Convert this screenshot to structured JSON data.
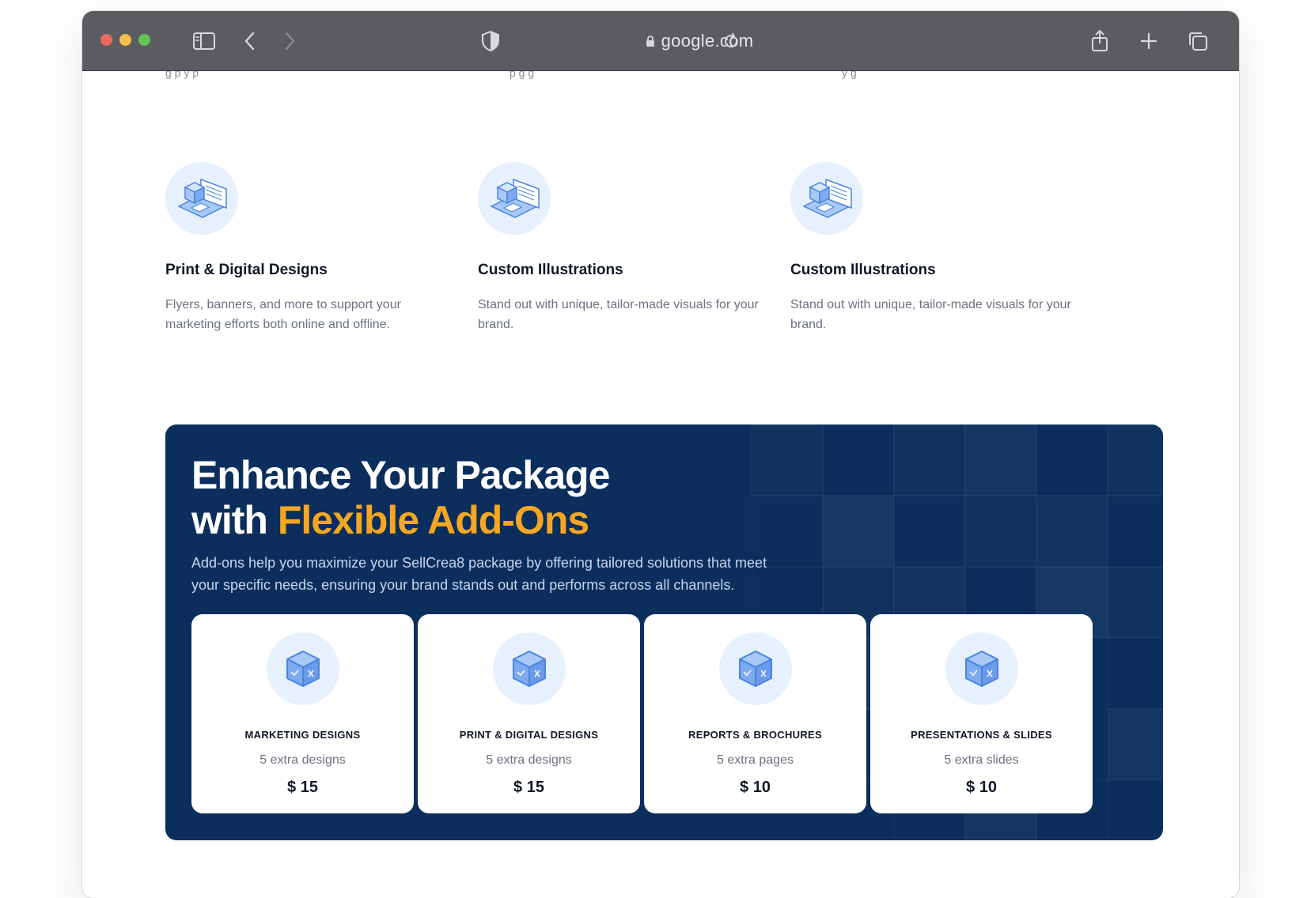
{
  "browser": {
    "address": "google.com"
  },
  "cut_text": {
    "left": "g         p  y   p",
    "middle": "p                  g g",
    "right": "      y      g"
  },
  "features": [
    {
      "title": "Print & Digital Designs",
      "desc": "Flyers, banners, and more to support your marketing efforts both online and offline."
    },
    {
      "title": "Custom Illustrations",
      "desc": "Stand out with unique, tailor-made visuals for your brand."
    },
    {
      "title": "Custom Illustrations",
      "desc": "Stand out with unique, tailor-made visuals for your brand."
    }
  ],
  "addons": {
    "heading_line1": "Enhance Your Package",
    "heading_with": "with ",
    "heading_accent": "Flexible Add-Ons",
    "description": "Add-ons help you maximize your SellCrea8 package by offering tailored solutions that meet your specific needs, ensuring your brand stands out and performs across all channels.",
    "accent_color": "#f5a623",
    "panel_color": "#0b2e5c",
    "cards": [
      {
        "title": "MARKETING DESIGNS",
        "sub": "5 extra designs",
        "price": "$ 15"
      },
      {
        "title": "PRINT & DIGITAL DESIGNS",
        "sub": "5 extra designs",
        "price": "$ 15"
      },
      {
        "title": "REPORTS & BROCHURES",
        "sub": "5 extra pages",
        "price": "$ 10"
      },
      {
        "title": "PRESENTATIONS & SLIDES",
        "sub": "5 extra slides",
        "price": "$ 10"
      }
    ]
  }
}
